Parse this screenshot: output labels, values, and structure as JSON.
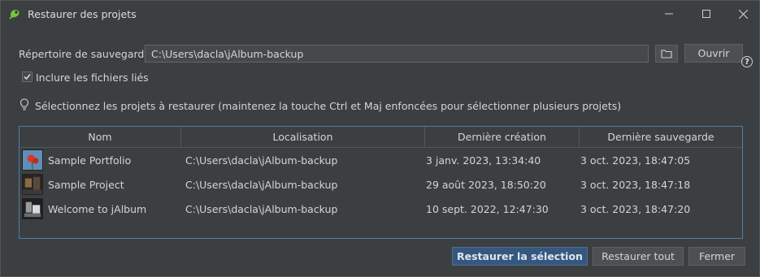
{
  "window": {
    "title": "Restaurer des projets"
  },
  "form": {
    "backup_dir_label": "Répertoire de sauvegarde",
    "backup_dir_value": "C:\\Users\\dacla\\jAlbum-backup",
    "open_label": "Ouvrir",
    "include_linked_label": "Inclure les fichiers liés",
    "include_linked_checked": true
  },
  "hint": "Sélectionnez les projets à restaurer (maintenez la touche Ctrl et Maj enfoncées pour sélectionner plusieurs projets)",
  "table": {
    "columns": [
      "Nom",
      "Localisation",
      "Dernière création",
      "Dernière sauvegarde"
    ],
    "rows": [
      {
        "name": "Sample Portfolio",
        "location": "C:\\Users\\dacla\\jAlbum-backup",
        "created": "3 janv. 2023, 13:34:40",
        "saved": "3 oct. 2023, 18:47:05"
      },
      {
        "name": "Sample Project",
        "location": "C:\\Users\\dacla\\jAlbum-backup",
        "created": "29 août 2023, 18:50:20",
        "saved": "3 oct. 2023, 18:47:18"
      },
      {
        "name": "Welcome to jAlbum",
        "location": "C:\\Users\\dacla\\jAlbum-backup",
        "created": "10 sept. 2022, 12:47:30",
        "saved": "3 oct. 2023, 18:47:20"
      }
    ]
  },
  "buttons": {
    "restore_selection": "Restaurer la sélection",
    "restore_all": "Restaurer tout",
    "close": "Fermer"
  },
  "colors": {
    "accent": "#365880",
    "background": "#3c3f41",
    "table_border": "#4d7ea8"
  }
}
